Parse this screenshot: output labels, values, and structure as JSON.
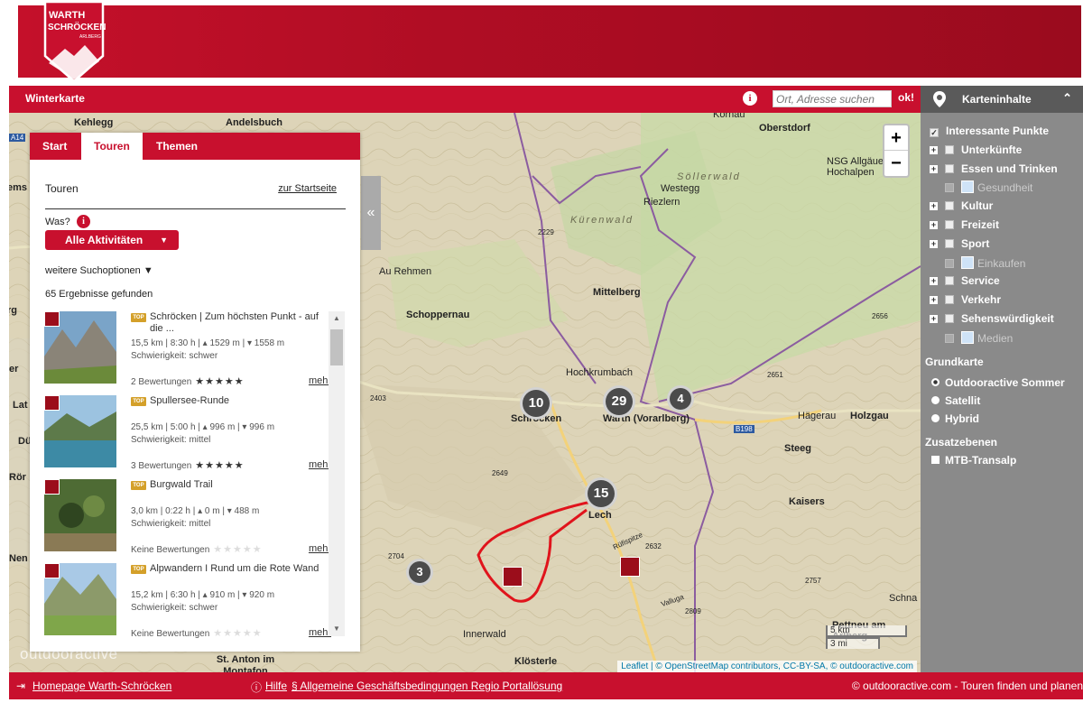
{
  "logo": {
    "line1": "WARTH",
    "line2": "SCHRÖCKEN",
    "line3": "ARLBERG"
  },
  "topbar": {
    "title": "Winterkarte",
    "search_placeholder": "Ort, Adresse suchen",
    "search_button": "ok!"
  },
  "panel": {
    "tabs": [
      "Start",
      "Touren",
      "Themen"
    ],
    "active_tab": "Touren",
    "title": "Touren",
    "home_link": "zur Startseite",
    "was_label": "Was?",
    "activity_select": "Alle Aktivitäten",
    "more_options": "weitere Suchoptionen ▼",
    "results": "65 Ergebnisse gefunden",
    "tours": [
      {
        "title": "Schröcken | Zum höchsten Punkt - auf die ...",
        "line1": "15,5 km | 8:30 h | ▴ 1529 m | ▾ 1558 m",
        "line2": "Schwierigkeit: schwer",
        "ratings": "2 Bewertungen",
        "stars": "★★★★★",
        "more": "mehr",
        "type_icon": "hiking-icon"
      },
      {
        "title": "Spullersee-Runde",
        "line1": "25,5 km | 5:00 h | ▴ 996 m | ▾ 996 m",
        "line2": "Schwierigkeit: mittel",
        "ratings": "3 Bewertungen",
        "stars": "★★★★★",
        "more": "mehr",
        "type_icon": "mountainbike-icon"
      },
      {
        "title": "Burgwald Trail",
        "line1": "3,0 km | 0:22 h | ▴ 0 m | ▾ 488 m",
        "line2": "Schwierigkeit: mittel",
        "ratings": "Keine Bewertungen",
        "stars": "★★★★★",
        "more": "mehr",
        "type_icon": "mountainbike-icon"
      },
      {
        "title": "Alpwandern I Rund um die Rote Wand",
        "line1": "15,2 km | 6:30 h | ▴ 910 m | ▾ 920 m",
        "line2": "Schwierigkeit: schwer",
        "ratings": "Keine Bewertungen",
        "stars": "★★★★★",
        "more": "mehr",
        "type_icon": "hiking-group-icon"
      }
    ],
    "top_tag": "TOP"
  },
  "map": {
    "places": [
      "Kehlegg",
      "Andelsbuch",
      "Oberstdorf",
      "NSG Allgäuer Hochalpen",
      "Söllerwald",
      "Westegg",
      "Riezlern",
      "Kürenwald",
      "Au Rehmen",
      "Schoppernau",
      "Mittelberg",
      "Hochkrumbach",
      "Schröcken",
      "Warth (Vorarlberg)",
      "Hägerau",
      "Holzgau",
      "Steeg",
      "Kaisers",
      "Lech",
      "Rüfispitze",
      "Valluga",
      "Innerwald",
      "Klösterle",
      "St. Anton im Montafon",
      "Schna",
      "Pettneu am Arlberg",
      "Kornau"
    ],
    "peaks": [
      "2229",
      "2656",
      "2651",
      "2403",
      "2649",
      "2632",
      "2704",
      "2757",
      "2809"
    ],
    "clusters": [
      "10",
      "29",
      "4",
      "15",
      "3"
    ],
    "road": "B198",
    "highway": "A14",
    "scale_km": "5 km",
    "scale_mi": "3 mi",
    "attribution": "Leaflet | © OpenStreetMap contributors, CC-BY-SA, © outdooractive.com",
    "watermark": "outdooractive",
    "left_edge": [
      "ems",
      "rg",
      "Lat",
      "Dü",
      "Rör",
      "Nen",
      "er"
    ]
  },
  "sidebar": {
    "title": "Karteninhalte",
    "layers": [
      {
        "label": "Interessante Punkte",
        "checked": true,
        "expand": false,
        "dim": false
      },
      {
        "label": "Unterkünfte",
        "checked": false,
        "expand": true,
        "dim": false
      },
      {
        "label": "Essen und Trinken",
        "checked": false,
        "expand": true,
        "dim": false
      },
      {
        "label": "Gesundheit",
        "checked": false,
        "expand": false,
        "dim": true
      },
      {
        "label": "Kultur",
        "checked": false,
        "expand": true,
        "dim": false
      },
      {
        "label": "Freizeit",
        "checked": false,
        "expand": true,
        "dim": false
      },
      {
        "label": "Sport",
        "checked": false,
        "expand": true,
        "dim": false
      },
      {
        "label": "Einkaufen",
        "checked": false,
        "expand": false,
        "dim": true
      },
      {
        "label": "Service",
        "checked": false,
        "expand": true,
        "dim": false
      },
      {
        "label": "Verkehr",
        "checked": false,
        "expand": true,
        "dim": false
      },
      {
        "label": "Sehenswürdigkeit",
        "checked": false,
        "expand": true,
        "dim": false
      },
      {
        "label": "Medien",
        "checked": false,
        "expand": false,
        "dim": true
      }
    ],
    "base_title": "Grundkarte",
    "base_options": [
      "Outdooractive Sommer",
      "Satellit",
      "Hybrid"
    ],
    "base_selected": "Outdooractive Sommer",
    "extra_title": "Zusatzebenen",
    "extra_layers": [
      "MTB-Transalp"
    ]
  },
  "footer": {
    "homepage": "Homepage Warth-Schröcken",
    "help": "Hilfe",
    "terms": "§ Allgemeine Geschäftsbedingungen Regio Portallösung",
    "credit": "© outdooractive.com - Touren finden und planen"
  },
  "colors": {
    "brand_red": "#c8102e",
    "sidebar_grey": "#8a8a8a"
  }
}
